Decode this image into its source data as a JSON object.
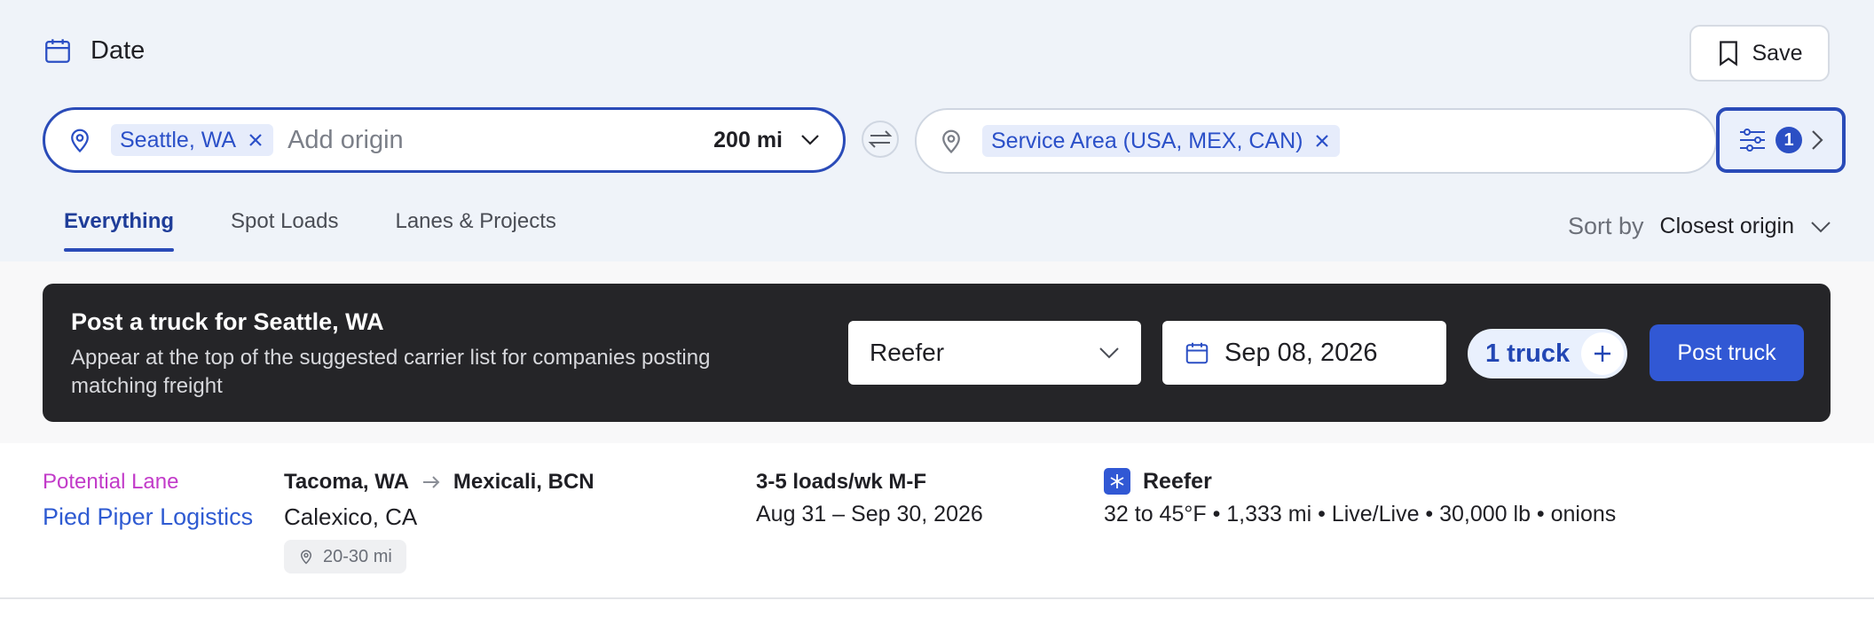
{
  "header": {
    "date_label": "Date",
    "save_label": "Save"
  },
  "search": {
    "origin_chip": "Seattle, WA",
    "origin_placeholder": "Add origin",
    "radius": "200 mi",
    "destination_chip": "Service Area (USA, MEX, CAN)",
    "filter_count": "1"
  },
  "tabs": [
    {
      "label": "Everything",
      "active": true
    },
    {
      "label": "Spot Loads",
      "active": false
    },
    {
      "label": "Lanes & Projects",
      "active": false
    }
  ],
  "sort": {
    "label": "Sort by",
    "value": "Closest origin"
  },
  "post_truck": {
    "title": "Post a truck for Seattle, WA",
    "subtitle": "Appear at the top of the suggested carrier list for companies posting matching freight",
    "equipment": "Reefer",
    "date": "Sep 08, 2026",
    "truck_count": "1 truck",
    "button_label": "Post truck"
  },
  "results": [
    {
      "tag": "Potential Lane",
      "company": "Pied Piper Logistics",
      "origin": "Tacoma, WA",
      "destination": "Mexicali, BCN",
      "city": "Calexico, CA",
      "distance": "20-30 mi",
      "frequency": "3-5 loads/wk M-F",
      "dates": "Aug 31 – Sep 30, 2026",
      "equipment": "Reefer",
      "details": "32 to 45°F • 1,333 mi • Live/Live • 30,000 lb • onions"
    }
  ],
  "colors": {
    "accent": "#2a4bb8",
    "primary_button": "#3158d4",
    "tag": "#c23bc9",
    "dark_card": "#252528"
  }
}
